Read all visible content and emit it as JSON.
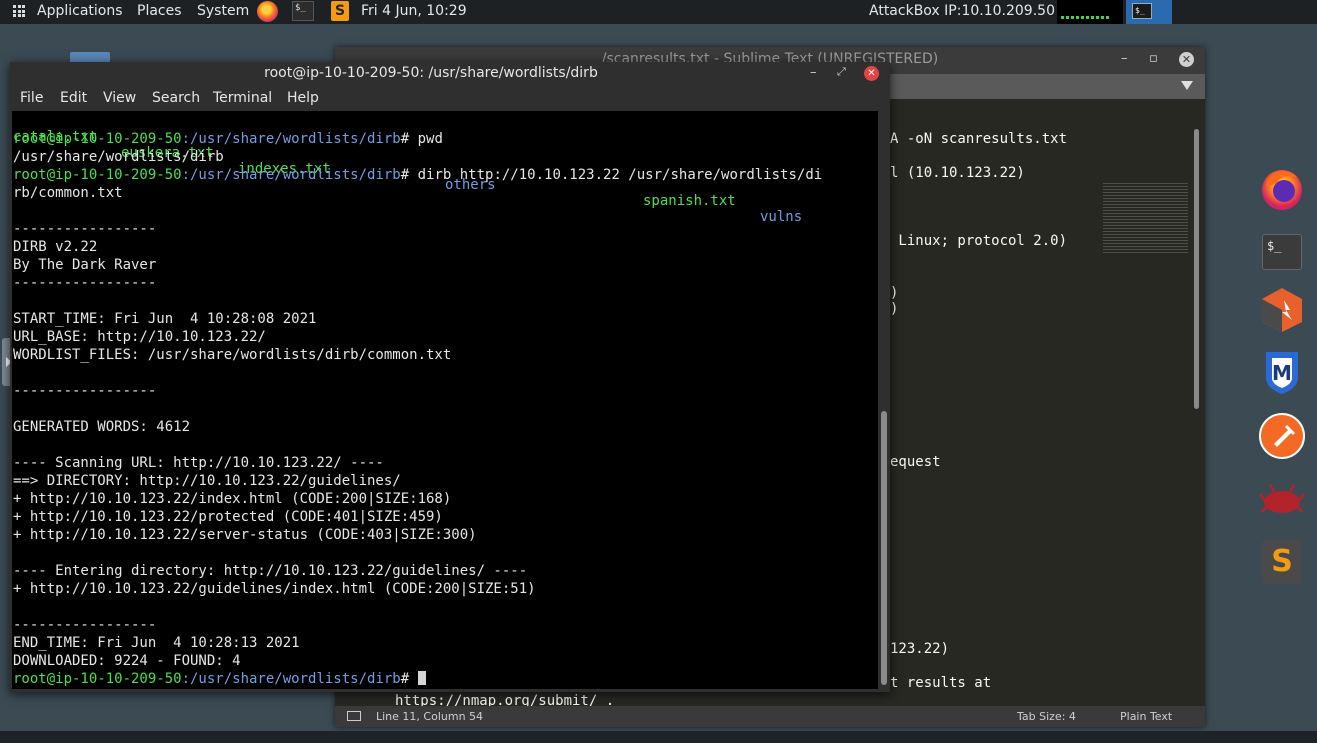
{
  "top_panel": {
    "applications": "Applications",
    "places": "Places",
    "system": "System",
    "clock": "Fri 4 Jun, 10:29",
    "attackbox_ip": "AttackBox IP:10.10.209.50",
    "term_glyph": "$_",
    "sublime_glyph": "S"
  },
  "sublime": {
    "title": "/scanresults.txt - Sublime Text (UNREGISTERED)",
    "visible_fragments": [
      "A -oN scanresults.txt",
      "l (10.10.123.22)",
      " Linux; protocol 2.0)",
      ")",
      ")",
      "equest",
      "123.22)",
      "t results at"
    ],
    "bottom_fragment": "https://nmap.org/submit/ .",
    "status_position": "Line 11, Column 54",
    "status_tab_size": "Tab Size: 4",
    "status_syntax": "Plain Text"
  },
  "terminal": {
    "title": "root@ip-10-10-209-50: /usr/share/wordlists/dirb",
    "menu": [
      "File",
      "Edit",
      "View",
      "Search",
      "Terminal",
      "Help"
    ],
    "files_row": {
      "catala": "catala.txt",
      "euskera": "euskera.txt",
      "indexes": "indexes.txt",
      "others": "others",
      "spanish": "spanish.txt",
      "vulns": "vulns"
    },
    "prompt_user": "root@ip-10-10-209-50",
    "prompt_path": ":/usr/share/wordlists/dirb",
    "prompt_hash": "# ",
    "cmd_pwd": "pwd",
    "pwd_output": "/usr/share/wordlists/dirb",
    "cmd_dirb": "dirb http://10.10.123.22 /usr/share/wordlists/di",
    "cmd_dirb_wrap": "rb/common.txt",
    "lines": [
      "-----------------",
      "DIRB v2.22",
      "By The Dark Raver",
      "-----------------",
      "",
      "START_TIME: Fri Jun  4 10:28:08 2021",
      "URL_BASE: http://10.10.123.22/",
      "WORDLIST_FILES: /usr/share/wordlists/dirb/common.txt",
      "",
      "-----------------",
      "",
      "GENERATED WORDS: 4612",
      "",
      "---- Scanning URL: http://10.10.123.22/ ----",
      "==> DIRECTORY: http://10.10.123.22/guidelines/",
      "+ http://10.10.123.22/index.html (CODE:200|SIZE:168)",
      "+ http://10.10.123.22/protected (CODE:401|SIZE:459)",
      "+ http://10.10.123.22/server-status (CODE:403|SIZE:300)",
      "",
      "---- Entering directory: http://10.10.123.22/guidelines/ ----",
      "+ http://10.10.123.22/guidelines/index.html (CODE:200|SIZE:51)",
      "",
      "-----------------",
      "END_TIME: Fri Jun  4 10:28:13 2021",
      "DOWNLOADED: 9224 - FOUND: 4"
    ]
  },
  "dock": {
    "items": [
      "firefox-icon",
      "terminal-icon",
      "burpsuite-icon",
      "metasploit-icon",
      "postman-icon",
      "redbug-icon",
      "sublime-icon"
    ],
    "terminal_glyph": "$_",
    "metasploit_glyph": "M",
    "sublime_glyph": "S"
  },
  "colors": {
    "prompt_green": "#4ce04c",
    "path_blue": "#6f9fe6",
    "dir_blue": "#6f9fe6",
    "panel_bg": "#1e2124",
    "desktop_bg": "#3b4a53"
  }
}
